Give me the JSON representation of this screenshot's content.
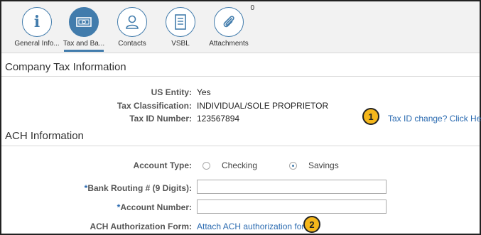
{
  "tabs": [
    {
      "label": "General Info...",
      "icon": "info-icon",
      "active": false
    },
    {
      "label": "Tax and Ba...",
      "icon": "bank-note-icon",
      "active": true
    },
    {
      "label": "Contacts",
      "icon": "person-icon",
      "active": false
    },
    {
      "label": "VSBL",
      "icon": "document-list-icon",
      "active": false
    },
    {
      "label": "Attachments",
      "icon": "paperclip-icon",
      "active": false,
      "count": "0"
    }
  ],
  "company_tax": {
    "title": "Company Tax Information",
    "us_entity_label": "US Entity:",
    "us_entity_value": "Yes",
    "tax_class_label": "Tax Classification:",
    "tax_class_value": "INDIVIDUAL/SOLE PROPRIETOR",
    "tax_id_label": "Tax ID Number:",
    "tax_id_value": "123567894",
    "tax_id_change_link": "Tax ID change? Click Here",
    "callout_1": "1"
  },
  "ach": {
    "title": "ACH Information",
    "account_type_label": "Account Type:",
    "checking_label": "Checking",
    "savings_label": "Savings",
    "selected_account_type": "Savings",
    "routing_required_mark": "*",
    "routing_label": "Bank Routing # (9 Digits):",
    "routing_value": "",
    "account_required_mark": "*",
    "account_label": "Account Number:",
    "account_value": "",
    "auth_form_label": "ACH Authorization Form:",
    "auth_form_link": "Attach ACH authorization form",
    "callout_2": "2"
  },
  "colors": {
    "accent": "#427cac",
    "link": "#2a6ab0",
    "callout": "#f5b71b"
  }
}
